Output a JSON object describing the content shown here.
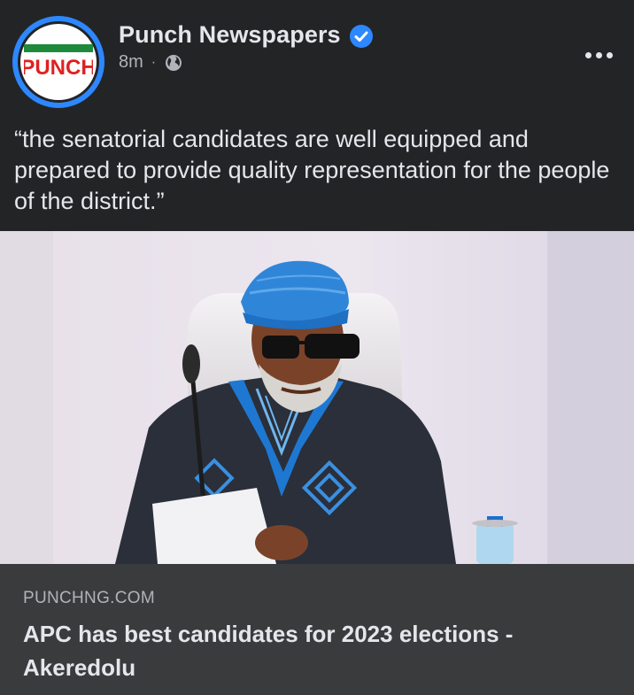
{
  "post": {
    "author": {
      "name": "Punch Newspapers",
      "avatar_logo_text": "PUNCH",
      "verified_icon": "verified-badge-icon"
    },
    "timestamp": "8m",
    "separator": "·",
    "audience_icon": "globe-icon",
    "more_icon": "more-options-icon",
    "text": "“the senatorial candidates are well equipped and prepared to provide quality representation for the people of the district.”",
    "image": {
      "subject": "photo-of-man-in-blue-cap-at-microphone"
    },
    "link": {
      "domain": "PUNCHNG.COM",
      "title": "APC has best candidates for 2023 elections - Akeredolu"
    }
  },
  "colors": {
    "background": "#232426",
    "card": "#3a3b3d",
    "accent": "#2d88ff",
    "text": "#e4e6eb",
    "muted": "#b0b3b8"
  }
}
